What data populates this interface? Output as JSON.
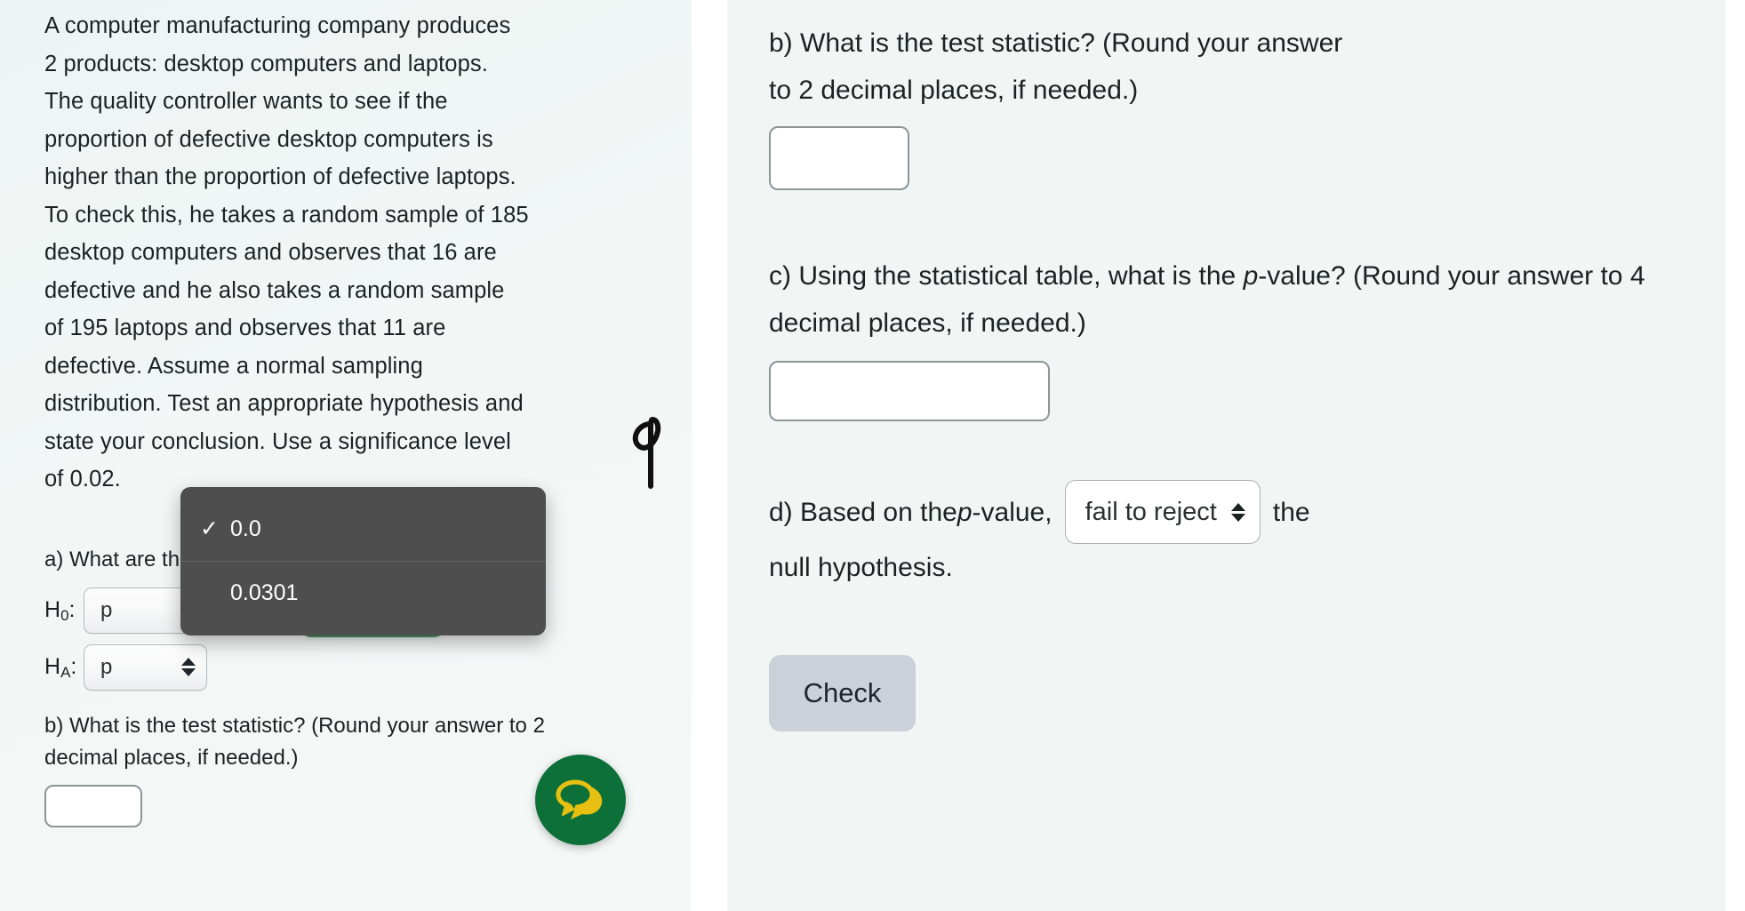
{
  "colors": {
    "panel_background": "#f1f6f5",
    "page_background": "#ffffff",
    "text": "#1b2221",
    "focus_ring_green": "#2f8246",
    "menu_background": "#4e4e4e",
    "check_button_background": "#ccd0d9",
    "chat_launcher_green": "#0d7038",
    "chat_bubble_yellow": "#e8c012"
  },
  "left_panel": {
    "prompt": "A computer manufacturing company produces 2 products: desktop computers and laptops. The quality controller wants to see if the proportion of defective desktop computers is higher than the proportion of defective laptops. To check this, he takes a random sample of 185 desktop computers and observes that 16 are defective and he also takes a random sample of 195 laptops and observes that 11 are defective. Assume a normal sampling distribution. Test an appropriate hypothesis and state your conclusion. Use a significance level of 0.02.",
    "question_a": "a) What are the null and alternative hypotheses?",
    "h0_label": "H",
    "h0_sub": "0",
    "h0_suffix": ":",
    "ha_label": "H",
    "ha_sub": "A",
    "ha_suffix": ":",
    "h0_param": "p",
    "h0_operator": "<",
    "h0_value": "0.0",
    "ha_param": "p",
    "question_b": "b) What is the test statistic? (Round your answer to 2 decimal places, if needed.)",
    "answer_b": ""
  },
  "dropdown_menu": {
    "name": "h0-value-options",
    "selected_index": 0,
    "items": [
      {
        "label": "0.0",
        "checked": true,
        "check_glyph": "✓"
      },
      {
        "label": "0.0301",
        "checked": false,
        "check_glyph": ""
      }
    ]
  },
  "right_panel": {
    "question_b_line1": "b) What is the test statistic? (Round your answer",
    "question_b_line2": "to 2 decimal places, if needed.)",
    "answer_b": "",
    "question_c_part1": "c) Using the statistical table, what is the ",
    "question_c_italic": "p",
    "question_c_part2": "-value? (Round your answer to 4 decimal places, if needed.)",
    "answer_c": "",
    "question_d_part1": "d) Based on the ",
    "question_d_italic": "p",
    "question_d_part2": "-value,",
    "question_d_after_select": "the",
    "question_d_line2": "null hypothesis.",
    "decision_value": "fail to reject",
    "check_button_label": "Check"
  },
  "icons": {
    "chat_launcher": "chat-bubbles-icon",
    "select_arrows": "updown-arrows-icon",
    "checkmark": "check-icon",
    "handwriting_left": "handwritten-q-mark",
    "handwriting_right": "handwritten-q-mark"
  }
}
